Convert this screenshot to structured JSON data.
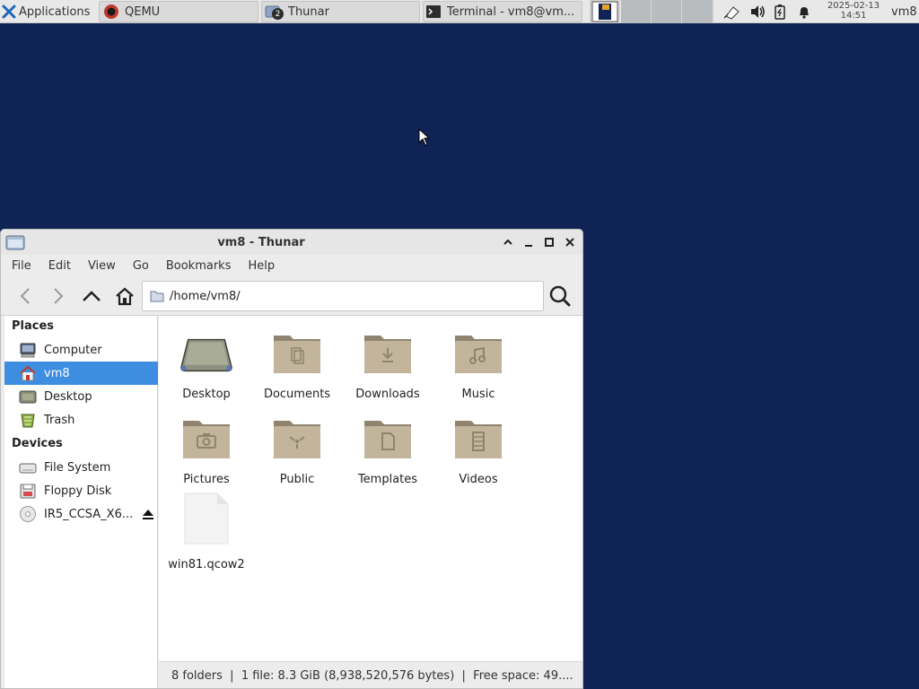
{
  "panel": {
    "applications_label": "Applications",
    "tasks": [
      {
        "label": "QEMU"
      },
      {
        "label": "Thunar",
        "badge": "2"
      },
      {
        "label": "Terminal - vm8@vm..."
      }
    ],
    "date": "2025-02-13",
    "time": "14:51",
    "user": "vm8",
    "tray_icons": [
      "network-icon",
      "volume-icon",
      "battery-icon",
      "notification-bell-icon"
    ]
  },
  "window": {
    "title": "vm8 - Thunar",
    "menu": [
      "File",
      "Edit",
      "View",
      "Go",
      "Bookmarks",
      "Help"
    ],
    "location": "/home/vm8/"
  },
  "sidebar": {
    "places_header": "Places",
    "places": [
      {
        "label": "Computer",
        "icon": "computer-icon"
      },
      {
        "label": "vm8",
        "icon": "home-icon",
        "selected": true
      },
      {
        "label": "Desktop",
        "icon": "desktop-icon"
      },
      {
        "label": "Trash",
        "icon": "trash-icon"
      }
    ],
    "devices_header": "Devices",
    "devices": [
      {
        "label": "File System",
        "icon": "drive-icon"
      },
      {
        "label": "Floppy Disk",
        "icon": "floppy-icon"
      },
      {
        "label": "IR5_CCSA_X6...",
        "icon": "optical-disc-icon",
        "eject": true
      }
    ]
  },
  "files": [
    {
      "name": "Desktop",
      "icon": "desktop-folder-icon"
    },
    {
      "name": "Documents",
      "icon": "documents-folder-icon"
    },
    {
      "name": "Downloads",
      "icon": "downloads-folder-icon"
    },
    {
      "name": "Music",
      "icon": "music-folder-icon"
    },
    {
      "name": "Pictures",
      "icon": "pictures-folder-icon"
    },
    {
      "name": "Public",
      "icon": "public-folder-icon"
    },
    {
      "name": "Templates",
      "icon": "templates-folder-icon"
    },
    {
      "name": "Videos",
      "icon": "videos-folder-icon"
    },
    {
      "name": "win81.qcow2",
      "icon": "file-icon"
    }
  ],
  "status": "8 folders  |  1 file: 8.3 GiB (8,938,520,576 bytes)  |  Free space: 49....",
  "colors": {
    "desktop_bg": "#0f2454",
    "selection": "#3d8ee0",
    "folder": "#b8ab93"
  }
}
